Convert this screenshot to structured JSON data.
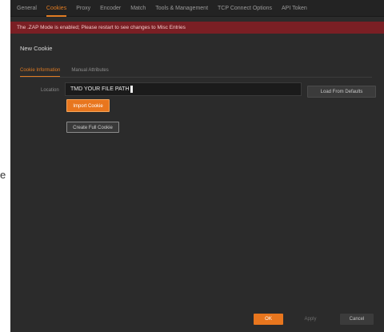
{
  "outside": {
    "glyph": "e"
  },
  "tabs": [
    {
      "label": "General"
    },
    {
      "label": "Cookies"
    },
    {
      "label": "Proxy"
    },
    {
      "label": "Encoder"
    },
    {
      "label": "Match"
    },
    {
      "label": "Tools & Management"
    },
    {
      "label": "TCP Connect Options"
    },
    {
      "label": "API Token"
    }
  ],
  "warning": {
    "text": "The .ZAP Mode is enabled; Please restart to see changes to Misc Entries"
  },
  "section_title": "New Cookie",
  "subtabs": [
    {
      "label": "Cookie Information"
    },
    {
      "label": "Manual Attributes"
    }
  ],
  "form": {
    "path_label": "Location",
    "path_value": "TMD YOUR FILE PATH"
  },
  "buttons": {
    "load_default": "Load From Defaults",
    "orange": "Import Cookie",
    "outline": "Create Full Cookie",
    "ok": "OK",
    "apply": "Apply",
    "cancel": "Cancel"
  },
  "colors": {
    "accent": "#e8761e",
    "background": "#2b2b2b",
    "warning_bg": "#7a1f24"
  }
}
